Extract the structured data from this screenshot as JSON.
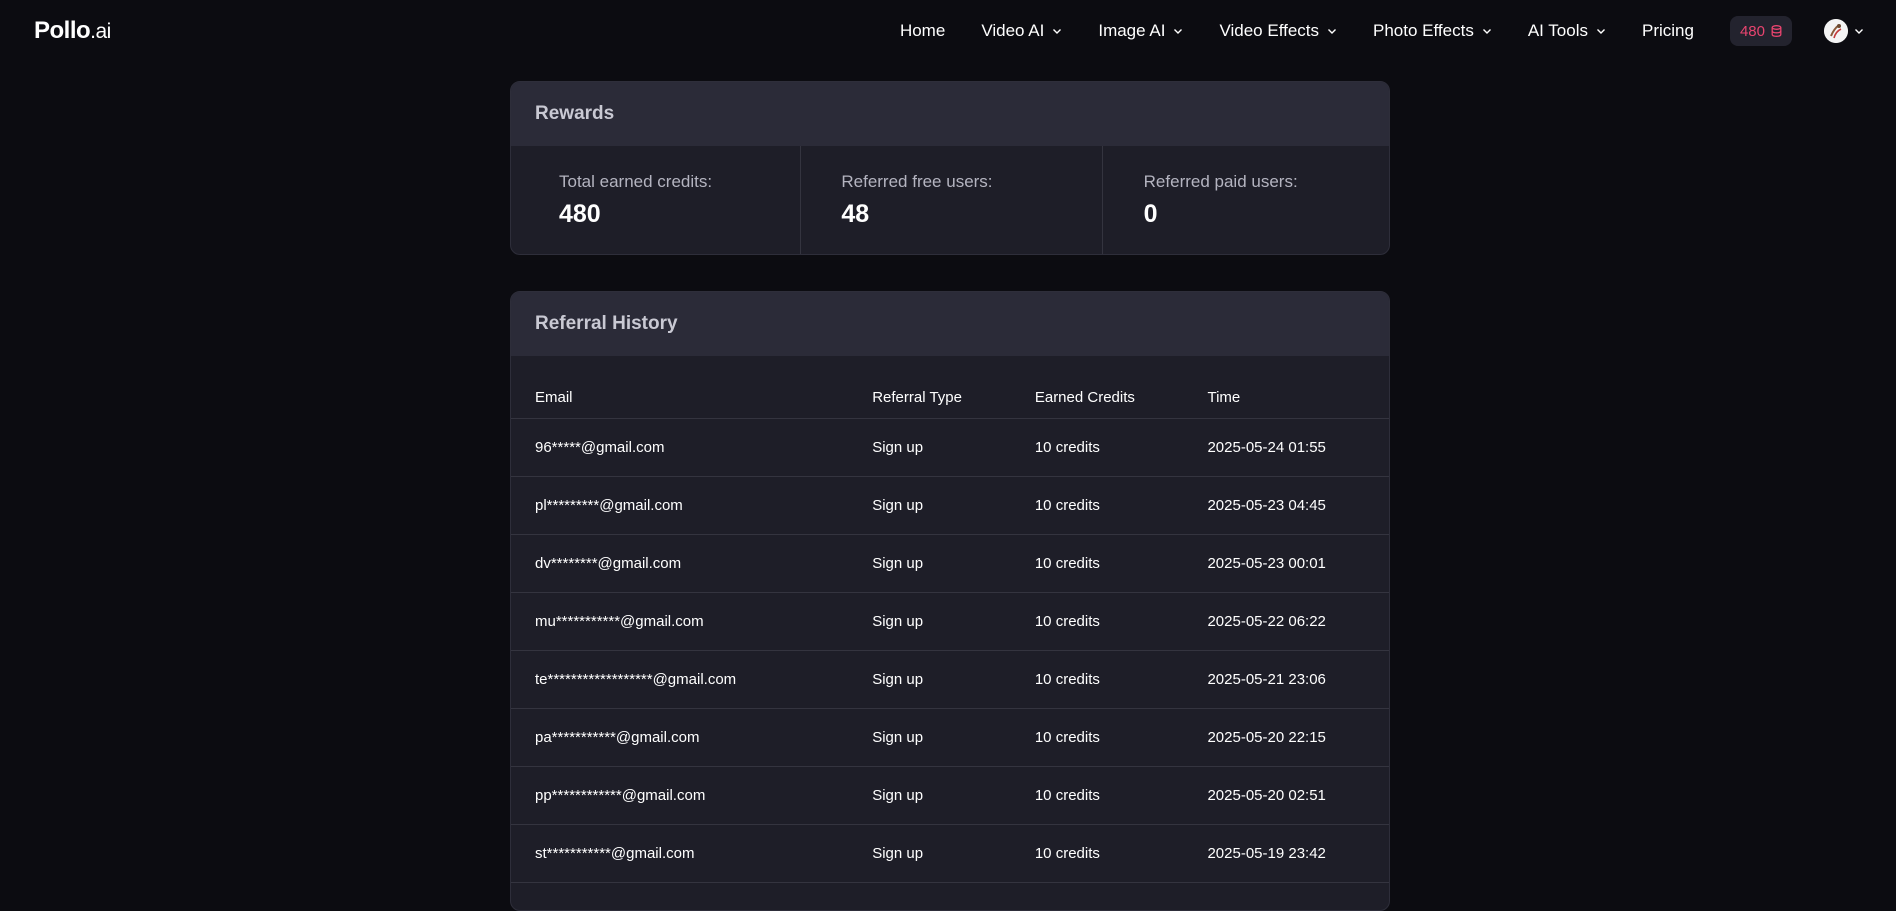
{
  "nav": {
    "logo_main": "Pollo",
    "logo_suffix": ".ai",
    "items": [
      {
        "label": "Home",
        "dropdown": false
      },
      {
        "label": "Video AI",
        "dropdown": true
      },
      {
        "label": "Image AI",
        "dropdown": true
      },
      {
        "label": "Video Effects",
        "dropdown": true
      },
      {
        "label": "Photo Effects",
        "dropdown": true
      },
      {
        "label": "AI Tools",
        "dropdown": true
      },
      {
        "label": "Pricing",
        "dropdown": false
      }
    ],
    "credits": "480"
  },
  "rewards": {
    "title": "Rewards",
    "stats": [
      {
        "label": "Total earned credits:",
        "value": "480"
      },
      {
        "label": "Referred free users:",
        "value": "48"
      },
      {
        "label": "Referred paid users:",
        "value": "0"
      }
    ]
  },
  "history": {
    "title": "Referral History",
    "columns": [
      "Email",
      "Referral Type",
      "Earned Credits",
      "Time"
    ],
    "rows": [
      [
        "96*****@gmail.com",
        "Sign up",
        "10 credits",
        "2025-05-24 01:55"
      ],
      [
        "pl*********@gmail.com",
        "Sign up",
        "10 credits",
        "2025-05-23 04:45"
      ],
      [
        "dv********@gmail.com",
        "Sign up",
        "10 credits",
        "2025-05-23 00:01"
      ],
      [
        "mu***********@gmail.com",
        "Sign up",
        "10 credits",
        "2025-05-22 06:22"
      ],
      [
        "te******************@gmail.com",
        "Sign up",
        "10 credits",
        "2025-05-21 23:06"
      ],
      [
        "pa***********@gmail.com",
        "Sign up",
        "10 credits",
        "2025-05-20 22:15"
      ],
      [
        "pp************@gmail.com",
        "Sign up",
        "10 credits",
        "2025-05-20 02:51"
      ],
      [
        "st***********@gmail.com",
        "Sign up",
        "10 credits",
        "2025-05-19 23:42"
      ]
    ]
  },
  "colors": {
    "background": "#0c0c11",
    "card": "#1e1e28",
    "card_header": "#2b2b38",
    "credit_accent": "#e8446f"
  },
  "icons": {
    "dropdown": "chevron-down-icon",
    "credits": "coin-stack-icon",
    "avatar": "user-avatar"
  }
}
